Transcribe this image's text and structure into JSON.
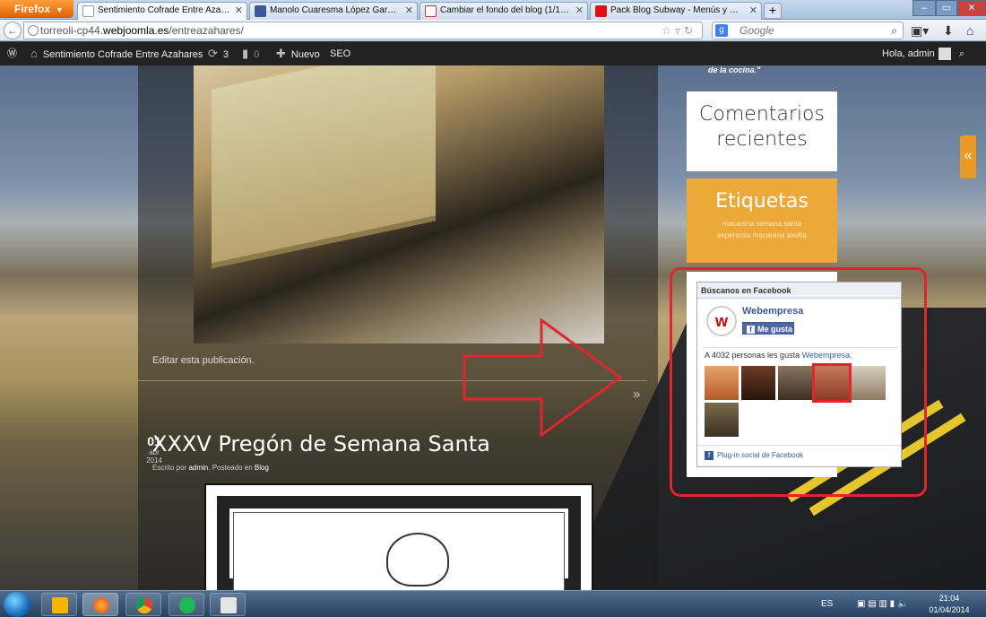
{
  "browser": {
    "menu_button": "Firefox",
    "tabs": [
      {
        "label": "Sentimiento Cofrade Entre Azahares Sentimie...",
        "favicon": "wordpress-icon",
        "active": true
      },
      {
        "label": "Manolo Cuaresma López García | Facebook",
        "favicon": "facebook-icon",
        "active": false
      },
      {
        "label": "Cambiar el fondo del blog (1/1) - Hosting Wo...",
        "favicon": "webempresa-icon",
        "active": false
      },
      {
        "label": "Pack Blog Subway - Menús y Widgets - Vide...",
        "favicon": "youtube-icon",
        "active": false
      }
    ],
    "new_tab": "+",
    "url_prefix": "torreoli-cp44.",
    "url_domain": "webjoomla.es",
    "url_path": "/entreazahares/",
    "search_placeholder": "Google",
    "window_controls": [
      "–",
      "▭",
      "✕"
    ]
  },
  "admin_bar": {
    "site_name": "Sentimiento Cofrade Entre Azahares",
    "updates_count": "3",
    "comments_count": "0",
    "new_label": "Nuevo",
    "seo_label": "SEO",
    "greeting": "Hola, admin"
  },
  "post": {
    "edit_link": "Editar esta publicación.",
    "pager": "»",
    "date_day": "01",
    "date_month": "abr",
    "date_year": "2014",
    "title": "XXXV Pregón de Semana Santa",
    "meta_prefix": "Escrito por",
    "meta_author": "admin",
    "meta_mid": ". Posteado en",
    "meta_category": "Blog"
  },
  "sidebar": {
    "quote_tail": "de la cocina.\"",
    "recent_comments_title": "Comentarios recientes",
    "tags_title": "Etiquetas",
    "tags": [
      "macarena",
      "semana santa",
      "esperanza macarena",
      "sevilla"
    ],
    "toggle": "«"
  },
  "facebook_widget": {
    "header": "Búscanos en Facebook",
    "page_name": "Webempresa",
    "like_button": "Me gusta",
    "count_text": "A 4032 personas les gusta",
    "count_link": "Webempresa.",
    "plugin_footer": "Plug-in social de Facebook"
  },
  "taskbar": {
    "language": "ES",
    "time": "21:04",
    "date": "01/04/2014"
  },
  "colors": {
    "accent_orange": "#eda83a",
    "facebook_blue": "#3b5998",
    "annotation_red": "#e0252e",
    "admin_bar": "#222222"
  }
}
